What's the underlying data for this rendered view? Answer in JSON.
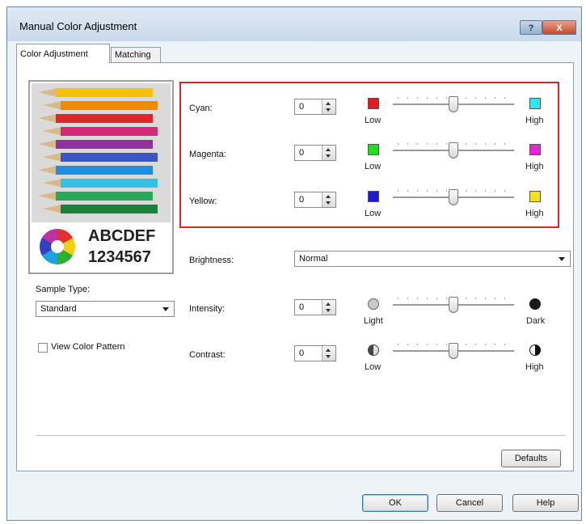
{
  "window": {
    "title": "Manual Color Adjustment"
  },
  "title_buttons": {
    "help": "?",
    "close": "X"
  },
  "tabs": [
    {
      "label": "Color Adjustment"
    },
    {
      "label": "Matching"
    }
  ],
  "sample": {
    "text_line1": "ABCDEF",
    "text_line2": "1234567",
    "pencil_colors": [
      "#f4c200",
      "#f08a00",
      "#e0262b",
      "#d6287a",
      "#9330a0",
      "#3a55c8",
      "#1f8ee0",
      "#36c0e8",
      "#2aa85a",
      "#17823a"
    ]
  },
  "sample_type": {
    "label": "Sample Type:",
    "value": "Standard"
  },
  "view_color_pattern": {
    "label": "View Color Pattern",
    "checked": false
  },
  "color_balance": [
    {
      "label": "Cyan:",
      "value": "0",
      "low_color": "#e8191e",
      "high_color": "#2ee6f0",
      "low": "Low",
      "high": "High",
      "level": 0.5
    },
    {
      "label": "Magenta:",
      "value": "0",
      "low_color": "#1fe01f",
      "high_color": "#e822d6",
      "low": "Low",
      "high": "High",
      "level": 0.5
    },
    {
      "label": "Yellow:",
      "value": "0",
      "low_color": "#1a1ad8",
      "high_color": "#f4e01a",
      "low": "Low",
      "high": "High",
      "level": 0.5
    }
  ],
  "brightness": {
    "label": "Brightness:",
    "value": "Normal"
  },
  "intensity": {
    "label": "Intensity:",
    "value": "0",
    "low": "Light",
    "high": "Dark",
    "level": 0.5
  },
  "contrast": {
    "label": "Contrast:",
    "value": "0",
    "low": "Low",
    "high": "High",
    "level": 0.5
  },
  "buttons": {
    "defaults": "Defaults",
    "ok": "OK",
    "cancel": "Cancel",
    "help": "Help"
  }
}
